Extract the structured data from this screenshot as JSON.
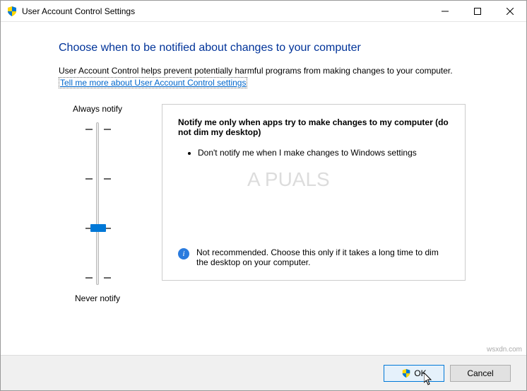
{
  "window": {
    "title": "User Account Control Settings"
  },
  "heading": "Choose when to be notified about changes to your computer",
  "description": "User Account Control helps prevent potentially harmful programs from making changes to your computer.",
  "help_link": "Tell me more about User Account Control settings",
  "slider": {
    "top_label": "Always notify",
    "bottom_label": "Never notify",
    "position": 2
  },
  "panel": {
    "title": "Notify me only when apps try to make changes to my computer (do not dim my desktop)",
    "bullets": [
      "Don't notify me when I make changes to Windows settings"
    ],
    "footer_text": "Not recommended. Choose this only if it takes a long time to dim the desktop on your computer."
  },
  "buttons": {
    "ok": "OK",
    "cancel": "Cancel"
  },
  "watermark": "A  PUALS",
  "attribution": "wsxdn.com"
}
